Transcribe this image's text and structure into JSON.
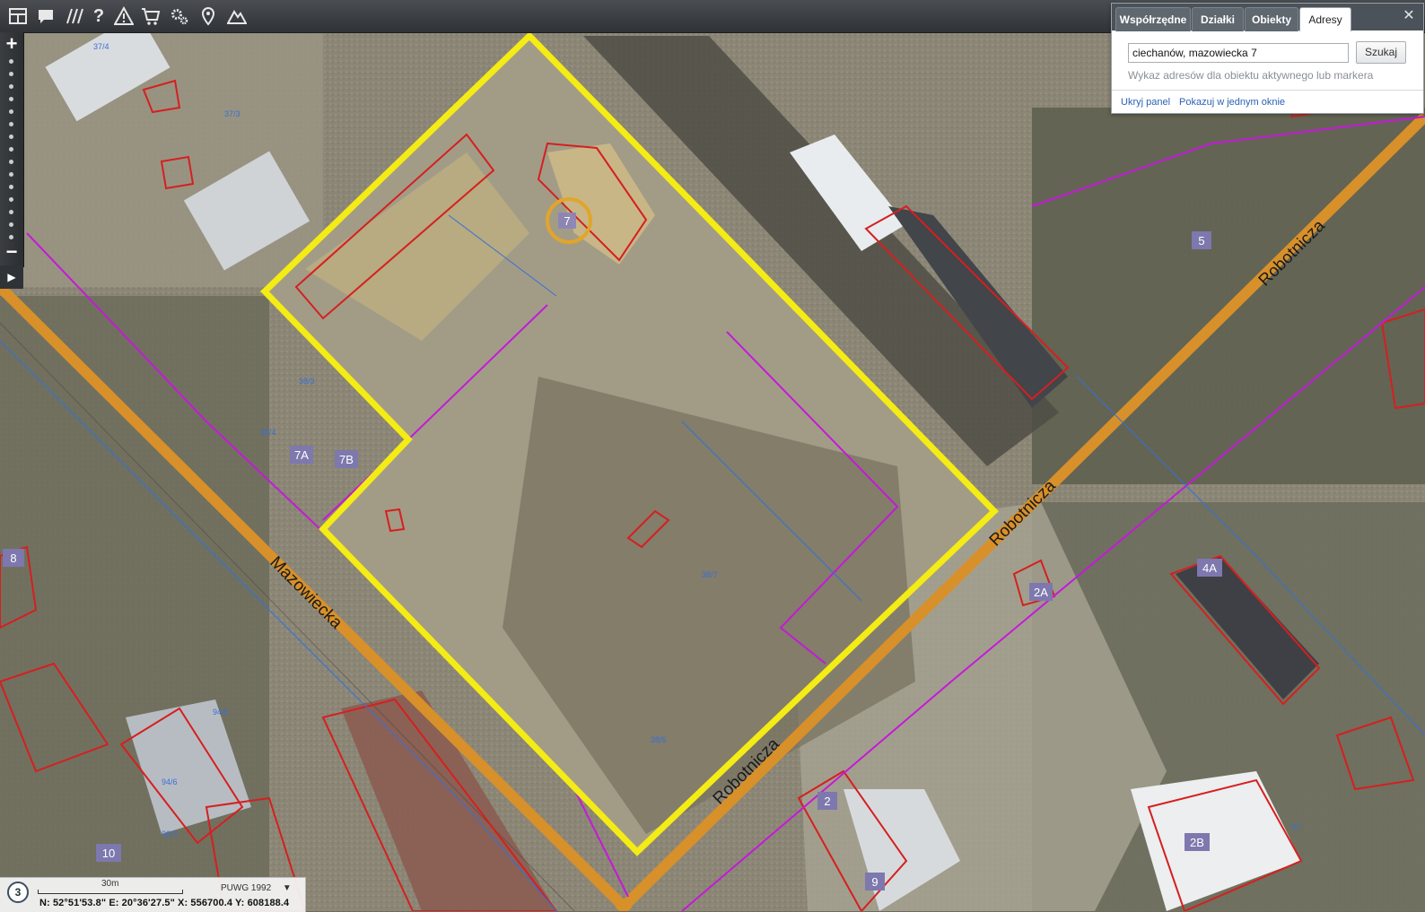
{
  "toolbar": {
    "icons": [
      "layers-icon",
      "comment-icon",
      "measure-icon",
      "help-icon",
      "warning-icon",
      "cart-icon",
      "settings-icon",
      "locate-icon",
      "terrain-icon"
    ]
  },
  "zoom": {
    "plus": "+",
    "minus": "−",
    "expand": "▶"
  },
  "panel": {
    "tabs": [
      "Współrzędne",
      "Działki",
      "Obiekty",
      "Adresy"
    ],
    "active_tab": "Adresy",
    "address_value": "ciechanów, mazowiecka 7",
    "search_label": "Szukaj",
    "hint": "Wykaz adresów dla obiektu aktywnego lub markera",
    "hide_link": "Ukryj panel",
    "single_window_link": "Pokazuj w jednym oknie"
  },
  "map": {
    "street_labels": [
      "Robotnicza",
      "Robotnicza",
      "Robotnicza",
      "Mazowiecka"
    ],
    "house_numbers": [
      "7",
      "5",
      "7A",
      "7B",
      "8",
      "2A",
      "4A",
      "2",
      "9",
      "10",
      "2B"
    ],
    "parcel_labels": [
      "37/4",
      "37/3",
      "38/3",
      "38/4",
      "38/7",
      "38/6",
      "94/5",
      "94/6",
      "96/3",
      "97"
    ]
  },
  "status": {
    "number": "3",
    "scale": "30m",
    "crs": "PUWG 1992",
    "crs_arrow": "▼",
    "coords": "N: 52°51'53.8\"  E: 20°36'27.5\"   X: 556700.4   Y: 608188.4"
  },
  "colors": {
    "highlight": "#f4ec14",
    "street": "#d8902a",
    "building_outline": "#d61f1f",
    "utility": "#c41ad8",
    "toolbar": "#383c40"
  }
}
